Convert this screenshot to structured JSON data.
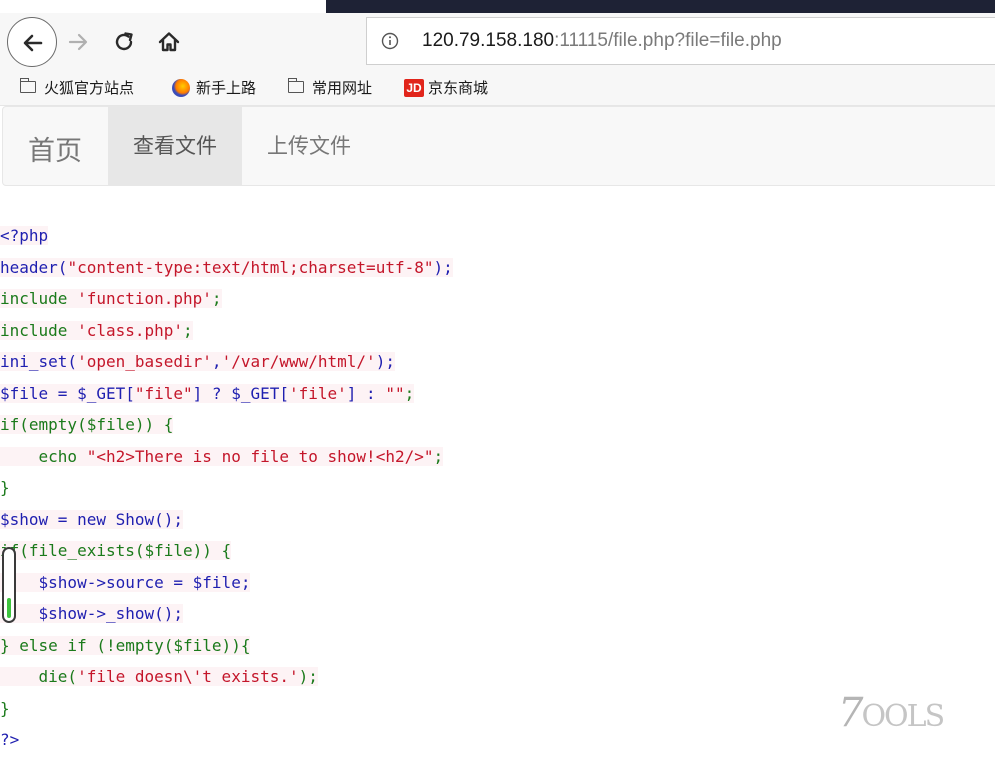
{
  "browser": {
    "url_host": "120.79.158.180",
    "url_rest": ":11115/file.php?file=file.php",
    "bookmarks": [
      {
        "label": "火狐官方站点",
        "icon": "folder-icon"
      },
      {
        "label": "新手上路",
        "icon": "firefox-icon"
      },
      {
        "label": "常用网址",
        "icon": "folder-icon"
      },
      {
        "label": "京东商城",
        "icon": "jd-icon"
      }
    ],
    "jd_badge": "JD"
  },
  "site": {
    "brand": "首页",
    "nav": [
      {
        "label": "查看文件",
        "active": true
      },
      {
        "label": "上传文件",
        "active": false
      }
    ]
  },
  "code": {
    "lines": [
      {
        "parts": [
          {
            "t": "<?php",
            "c": "blue"
          }
        ],
        "hl": true
      },
      {
        "parts": [
          {
            "t": "header(",
            "c": "blue"
          },
          {
            "t": "\"content-type:text/html;charset=utf-8\"",
            "c": "red"
          },
          {
            "t": ");",
            "c": "blue"
          }
        ],
        "hl": true
      },
      {
        "parts": [
          {
            "t": "include ",
            "c": "green"
          },
          {
            "t": "'function.php'",
            "c": "red"
          },
          {
            "t": ";",
            "c": "green"
          }
        ],
        "hl": true
      },
      {
        "parts": [
          {
            "t": "include ",
            "c": "green"
          },
          {
            "t": "'class.php'",
            "c": "red"
          },
          {
            "t": ";",
            "c": "green"
          }
        ],
        "hl": true
      },
      {
        "parts": [
          {
            "t": "ini_set(",
            "c": "blue"
          },
          {
            "t": "'open_basedir'",
            "c": "red"
          },
          {
            "t": ",",
            "c": "blue"
          },
          {
            "t": "'/var/www/html/'",
            "c": "red"
          },
          {
            "t": ");",
            "c": "blue"
          }
        ],
        "hl": true
      },
      {
        "parts": [
          {
            "t": "$file = $_GET[",
            "c": "blue"
          },
          {
            "t": "\"file\"",
            "c": "red"
          },
          {
            "t": "] ? $_GET[",
            "c": "blue"
          },
          {
            "t": "'file'",
            "c": "red"
          },
          {
            "t": "] : ",
            "c": "blue"
          },
          {
            "t": "\"\"",
            "c": "red"
          },
          {
            "t": ";",
            "c": "green"
          }
        ],
        "hl": true
      },
      {
        "parts": [
          {
            "t": "if(empty($file)) {",
            "c": "green"
          }
        ],
        "hl": true
      },
      {
        "parts": [
          {
            "t": "    echo ",
            "c": "green"
          },
          {
            "t": "\"<h2>There is no file to show!<h2/>\"",
            "c": "red"
          },
          {
            "t": ";",
            "c": "green"
          }
        ],
        "hl": true
      },
      {
        "parts": [
          {
            "t": "}",
            "c": "green"
          }
        ],
        "hl": false
      },
      {
        "parts": [
          {
            "t": "$show = new Show();",
            "c": "blue"
          }
        ],
        "hl": true
      },
      {
        "parts": [
          {
            "t": "if(file_exists($file)) {",
            "c": "green"
          }
        ],
        "hl": true
      },
      {
        "parts": [
          {
            "t": "    $show->source = $file;",
            "c": "blue"
          }
        ],
        "hl": true
      },
      {
        "parts": [
          {
            "t": "    $show->_show();",
            "c": "blue"
          }
        ],
        "hl": true
      },
      {
        "parts": [
          {
            "t": "} else if (!empty($file)){",
            "c": "green"
          }
        ],
        "hl": true
      },
      {
        "parts": [
          {
            "t": "    die(",
            "c": "green"
          },
          {
            "t": "'file doesn\\'t exists.'",
            "c": "red"
          },
          {
            "t": ");",
            "c": "green"
          }
        ],
        "hl": true
      },
      {
        "parts": [
          {
            "t": "}",
            "c": "green"
          }
        ],
        "hl": false
      },
      {
        "parts": [
          {
            "t": "?>",
            "c": "blue"
          }
        ],
        "hl": false
      }
    ]
  },
  "watermark": {
    "big": "7",
    "small": "OOLS"
  }
}
